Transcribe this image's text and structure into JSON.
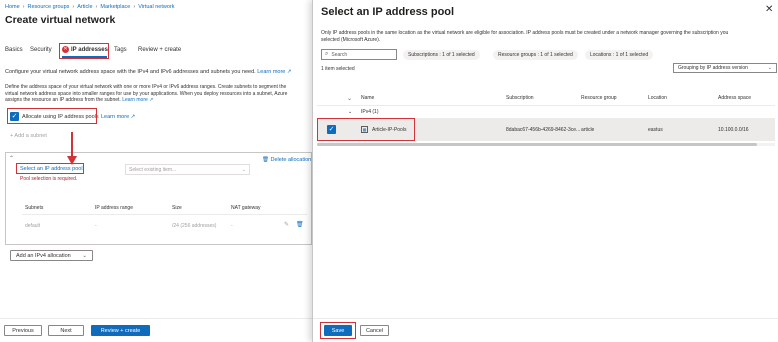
{
  "left": {
    "breadcrumb": [
      "Home",
      "Resource groups",
      "Article",
      "Marketplace",
      "Virtual network"
    ],
    "title": "Create virtual network",
    "tabs": [
      "Basics",
      "Security",
      "IP addresses",
      "Tags",
      "Review + create"
    ],
    "desc1": "Configure your virtual network address space with the IPv4 and IPv6 addresses and subnets you need.",
    "learn_more": "Learn more",
    "desc2a": "Define the address space of your virtual network with one or more IPv4 or IPv6 address ranges. Create subnets to segment the",
    "desc2b": "virtual network address space into smaller ranges for use by your applications. When you deploy resources into a subnet, Azure",
    "desc2c": "assigns the resource an IP address from the subnet.",
    "allocate_label": "Allocate using IP address pools",
    "add_subnet": "+ Add a subnet",
    "delete_allocation": "Delete allocation",
    "select_pool_link": "Select an IP address pool",
    "pool_required": "Pool selection is required.",
    "select_existing_placeholder": "Select existing item...",
    "table_headers": [
      "Subnets",
      "IP address range",
      "Size",
      "NAT gateway"
    ],
    "row": {
      "subnet": "default",
      "range": "-",
      "size": "/24 (256 addresses)",
      "nat": "-"
    },
    "add_ipv4": "Add an IPv4 allocation",
    "footer": {
      "previous": "Previous",
      "next": "Next",
      "review": "Review + create"
    }
  },
  "panel": {
    "title": "Select an IP address pool",
    "desc1": "Only IP address pools in the same location as the virtual network are eligible for association. IP address pools must be created under a network manager governing the subscription you",
    "desc2": "selected (Microsoft Azure).",
    "search_placeholder": "Search",
    "filters": [
      "Subscriptions : 1 of 1 selected",
      "Resource groups : 1 of 1 selected",
      "Locations : 1 of 1 selected"
    ],
    "selected_count": "1 item selected",
    "grouping": "Grouping by IP address version",
    "columns": [
      "Name",
      "Subscription",
      "Resource group",
      "Location",
      "Address space"
    ],
    "group_label": "IPv4 (1)",
    "row": {
      "name": "Article-IP-Pools",
      "subscription": "8dabac67-456b-4269-8462-3ce...",
      "resource_group": "article",
      "location": "eastus",
      "address_space": "10.100.0.0/16"
    },
    "save": "Save",
    "cancel": "Cancel"
  },
  "colors": {
    "accent": "#0f6cbd",
    "annotation": "#d13438"
  }
}
